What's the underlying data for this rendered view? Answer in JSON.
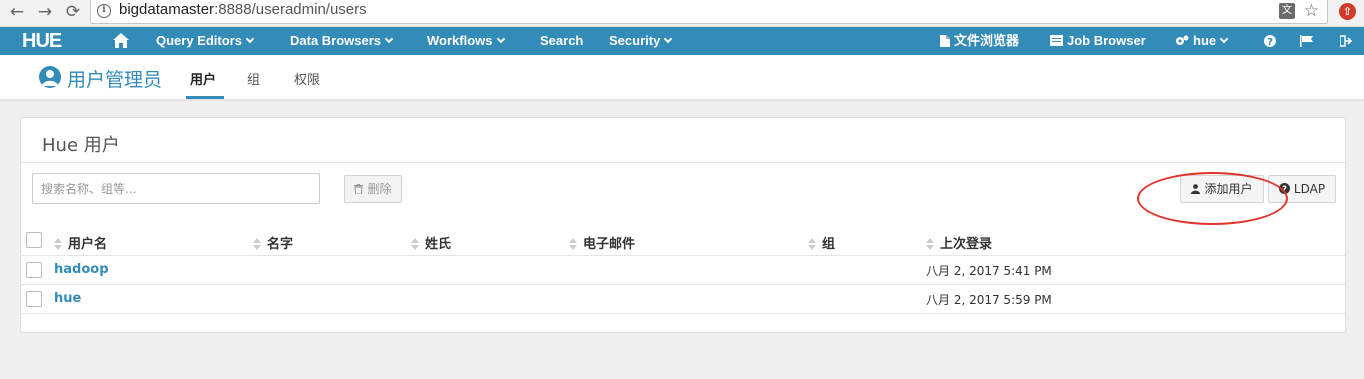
{
  "browser": {
    "url_host": "bigdatamaster",
    "url_rest": ":8888/useradmin/users"
  },
  "navbar": {
    "logo": "HUE",
    "items": [
      {
        "label": "Query Editors"
      },
      {
        "label": "Data Browsers"
      },
      {
        "label": "Workflows"
      },
      {
        "label": "Search"
      },
      {
        "label": "Security"
      }
    ],
    "right_items": [
      {
        "label": "文件浏览器"
      },
      {
        "label": "Job Browser"
      },
      {
        "label": "hue"
      }
    ],
    "color": "#338bb8"
  },
  "subheader": {
    "title": "用户管理员",
    "tabs": [
      {
        "label": "用户",
        "active": true
      },
      {
        "label": "组",
        "active": false
      },
      {
        "label": "权限",
        "active": false
      }
    ]
  },
  "card": {
    "title": "Hue 用户",
    "search_placeholder": "搜索名称、组等...",
    "delete_label": "删除",
    "add_user_label": "添加用户",
    "ldap_label": "LDAP"
  },
  "table": {
    "columns": [
      "用户名",
      "名字",
      "姓氏",
      "电子邮件",
      "组",
      "上次登录"
    ],
    "rows": [
      {
        "username": "hadoop",
        "first_name": "",
        "last_name": "",
        "email": "",
        "groups": "",
        "last_login": "八月 2, 2017 5:41 PM"
      },
      {
        "username": "hue",
        "first_name": "",
        "last_name": "",
        "email": "",
        "groups": "",
        "last_login": "八月 2, 2017 5:59 PM"
      }
    ]
  },
  "annotation_color": "#e3332c"
}
